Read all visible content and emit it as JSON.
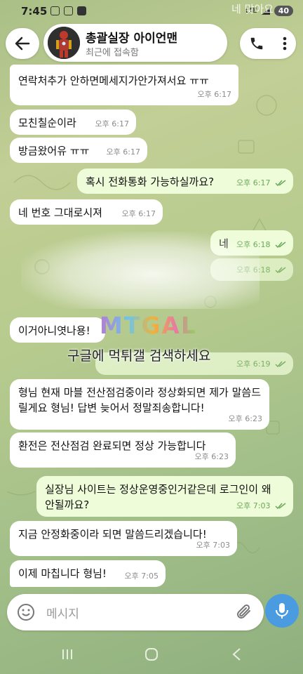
{
  "status_bar": {
    "time": "7:45",
    "network": "LTE",
    "battery": "40"
  },
  "header": {
    "chat_name": "총괄실장 아이언맨",
    "chat_status": "최근에 접속함",
    "overlay_text": "네 맞아요"
  },
  "messages": [
    {
      "side": "in",
      "text": "연락처추가 안하면메세지가안가져서요 ㅠㅠ",
      "time": "오후 6:17"
    },
    {
      "side": "in",
      "text": "모친칠순이라",
      "time": "오후 6:17"
    },
    {
      "side": "in",
      "text": "방금왔어유 ㅠㅠ",
      "time": "오후 6:17"
    },
    {
      "side": "out",
      "text": "혹시 전화통화 가능하실까요?",
      "time": "오후 6:17"
    },
    {
      "side": "in",
      "text": "네 번호 그대로시져",
      "time": "오후 6:17"
    },
    {
      "side": "out",
      "text": "네",
      "time": "오후 6:18"
    },
    {
      "side": "out",
      "text": "",
      "time": "오후 6:18"
    },
    {
      "side": "in",
      "text": "이거아니엿나용!",
      "time": ""
    },
    {
      "side": "out",
      "text": "",
      "time": "오후 6:19"
    },
    {
      "side": "in",
      "text": "형님 현재 마블 전산점검중이라 정상화되면 제가 말씀드릴게요 형님! 답변 늦어서 정말죄송합니다!",
      "time": "오후 6:23"
    },
    {
      "side": "in",
      "text": "환전은 전산점검 완료되면 정상 가능합니다",
      "time": "오후 6:23"
    },
    {
      "side": "out",
      "text": "실장님 사이트는 정상운영중인거같은데 로그인이 왜 안될까요?",
      "time": "오후 7:03"
    },
    {
      "side": "in",
      "text": "지금 안정화중이라 되면 말씀드리겠습니다!",
      "time": "오후 7:03"
    },
    {
      "side": "in",
      "text": "이제 마칩니다 형님!",
      "time": "오후 7:05"
    }
  ],
  "watermark": {
    "logo": "MTGAL",
    "text": "구글에 먹튀갤 검색하세요"
  },
  "input": {
    "placeholder": "메시지"
  },
  "colors": {
    "incoming": "#ffffff",
    "outgoing": "#eefcd9",
    "accent": "#4a9be0",
    "tick": "#6aa85a"
  }
}
